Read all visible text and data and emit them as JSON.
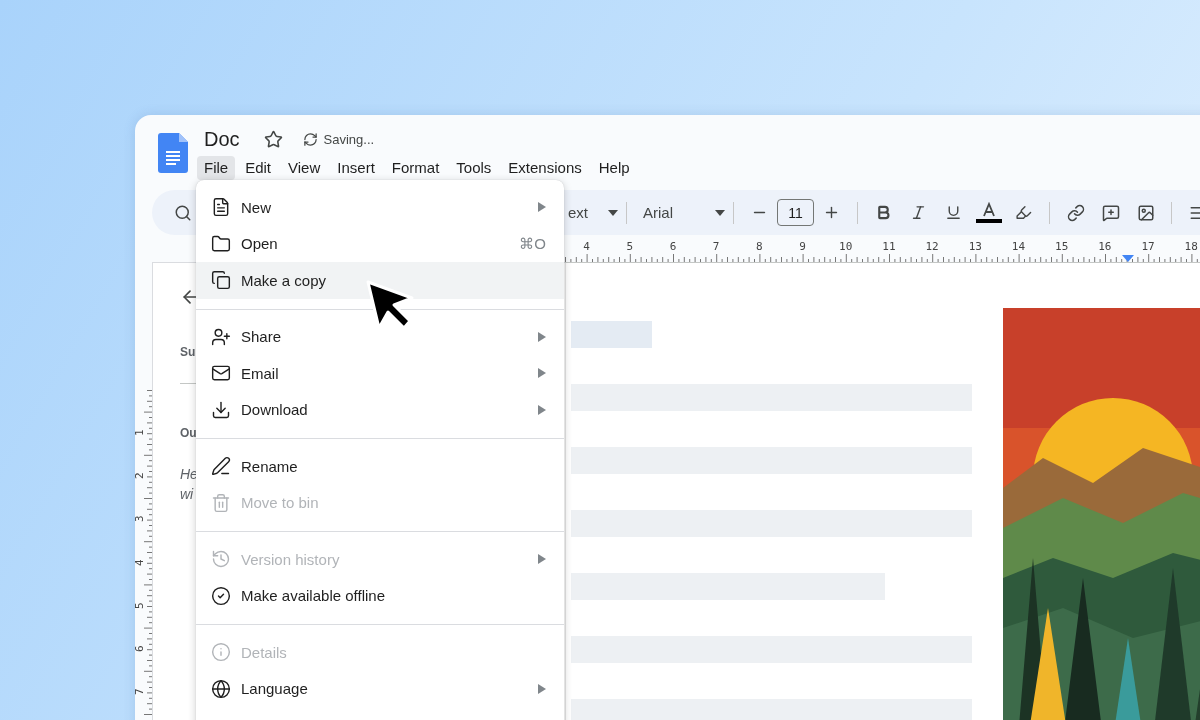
{
  "window": {
    "doc_title": "Doc",
    "status": "Saving..."
  },
  "menubar": [
    {
      "label": "File",
      "selected": true
    },
    {
      "label": "Edit",
      "selected": false
    },
    {
      "label": "View",
      "selected": false
    },
    {
      "label": "Insert",
      "selected": false
    },
    {
      "label": "Format",
      "selected": false
    },
    {
      "label": "Tools",
      "selected": false
    },
    {
      "label": "Extensions",
      "selected": false
    },
    {
      "label": "Help",
      "selected": false
    }
  ],
  "toolbar": {
    "style_dropdown": "ext",
    "font_dropdown": "Arial",
    "font_size": "11"
  },
  "ruler": {
    "horizontal": [
      "4",
      "5",
      "6",
      "7",
      "8",
      "9",
      "10",
      "11",
      "12",
      "13",
      "14",
      "15",
      "16",
      "17",
      "18"
    ],
    "vertical": [
      "1",
      "2",
      "3",
      "4",
      "5",
      "6",
      "7"
    ]
  },
  "outline_panel": {
    "summary_label": "Su",
    "outline_label": "Ou",
    "note_lines": [
      "He",
      "wi"
    ]
  },
  "file_menu": {
    "sections": [
      [
        {
          "label": "New",
          "selected": false,
          "disabled": false,
          "submenu": true
        },
        {
          "label": "Open",
          "selected": false,
          "disabled": false,
          "submenu": false,
          "shortcut": "⌘O"
        },
        {
          "label": "Make a copy",
          "selected": true,
          "disabled": false,
          "submenu": false
        }
      ],
      [
        {
          "label": "Share",
          "selected": false,
          "disabled": false,
          "submenu": true
        },
        {
          "label": "Email",
          "selected": false,
          "disabled": false,
          "submenu": true
        },
        {
          "label": "Download",
          "selected": false,
          "disabled": false,
          "submenu": true
        }
      ],
      [
        {
          "label": "Rename",
          "selected": false,
          "disabled": false,
          "submenu": false
        },
        {
          "label": "Move to bin",
          "selected": false,
          "disabled": true,
          "submenu": false
        }
      ],
      [
        {
          "label": "Version history",
          "selected": false,
          "disabled": true,
          "submenu": true
        },
        {
          "label": "Make available offline",
          "selected": false,
          "disabled": false,
          "submenu": false
        }
      ],
      [
        {
          "label": "Details",
          "selected": false,
          "disabled": true,
          "submenu": false
        },
        {
          "label": "Language",
          "selected": false,
          "disabled": false,
          "submenu": true
        }
      ]
    ]
  }
}
